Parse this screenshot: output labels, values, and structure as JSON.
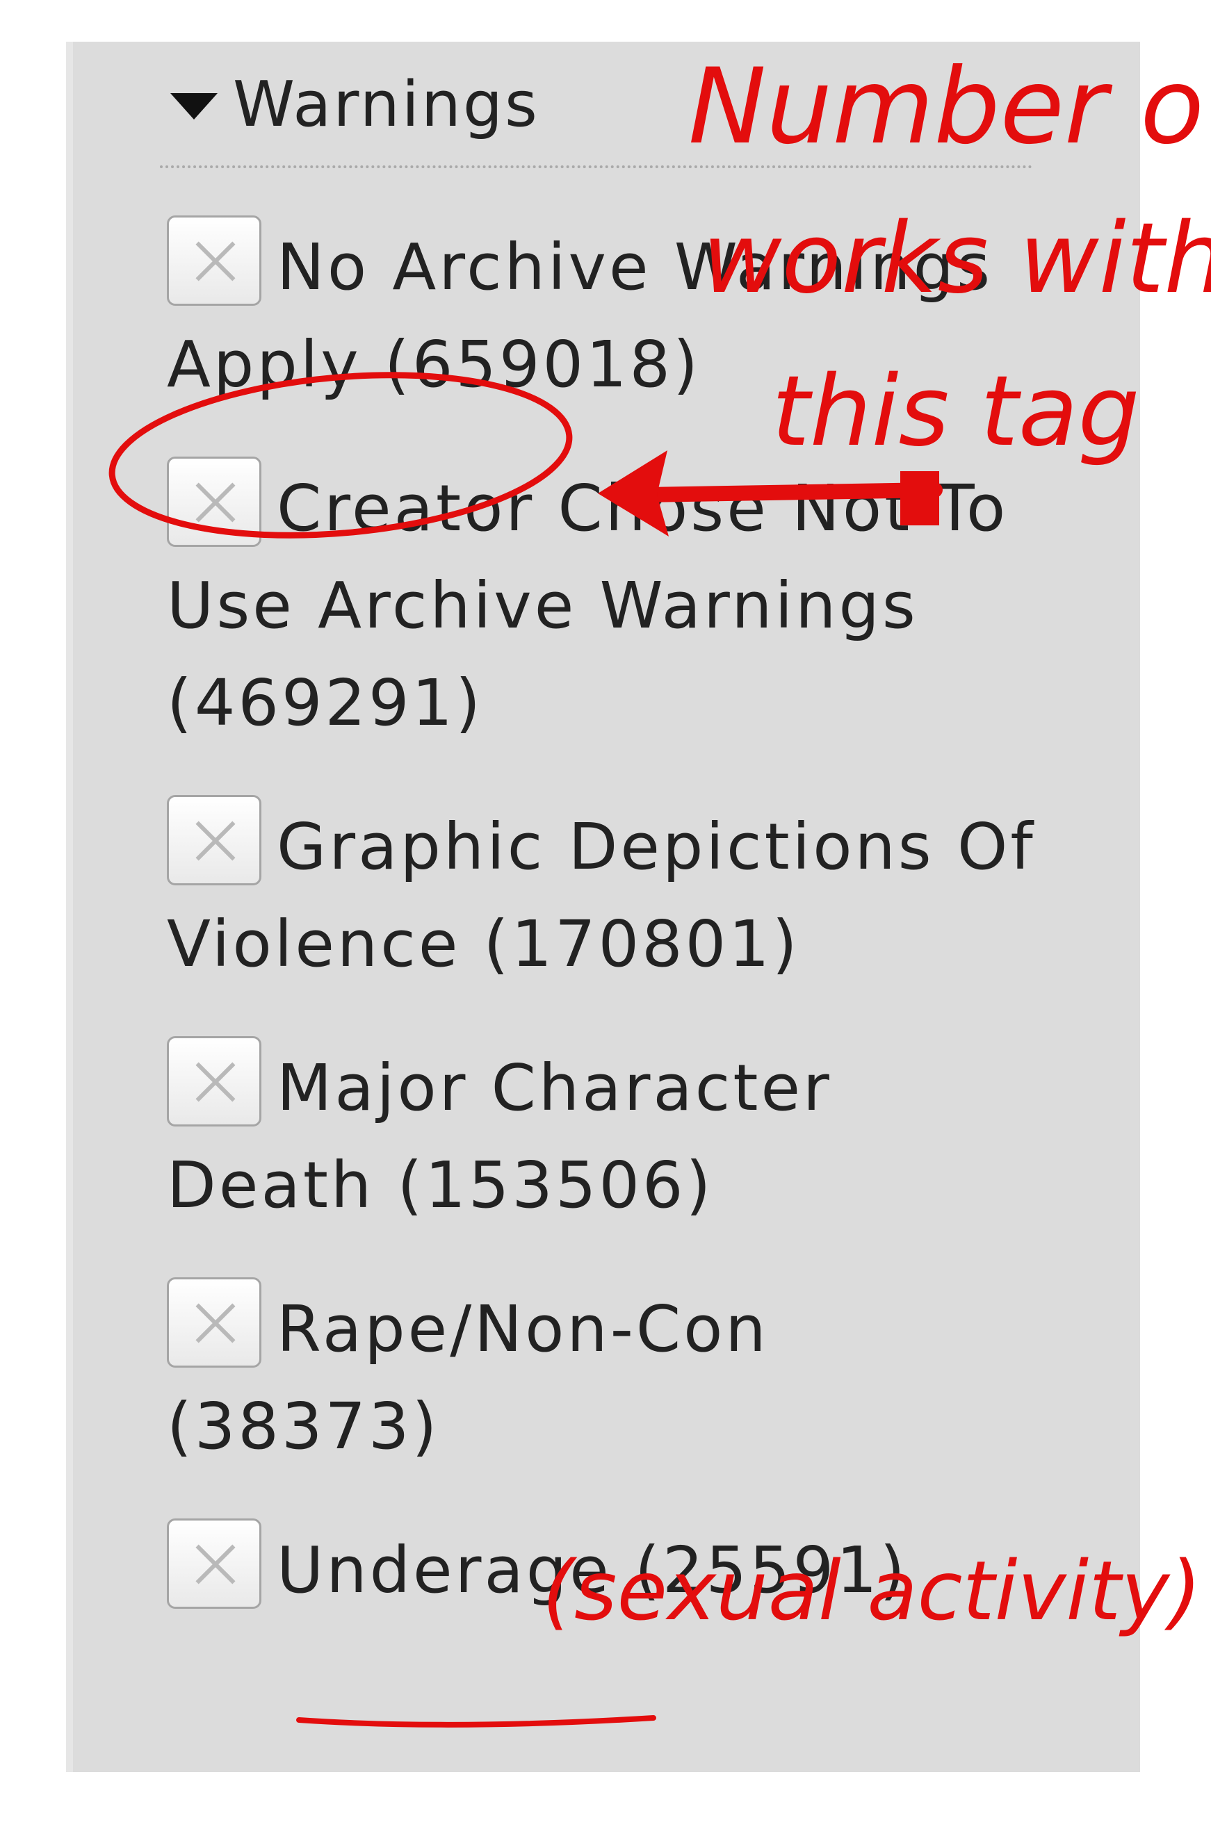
{
  "section": {
    "title": "Warnings",
    "collapse_icon": "triangle-down-icon"
  },
  "filters": [
    {
      "label": "No Archive Warnings Apply (659018)",
      "checkbox_icon": "x-icon"
    },
    {
      "label": "Creator Chose Not To Use Archive Warnings (469291)",
      "checkbox_icon": "x-icon"
    },
    {
      "label": "Graphic Depictions Of Violence (170801)",
      "checkbox_icon": "x-icon"
    },
    {
      "label": "Major Character Death (153506)",
      "checkbox_icon": "x-icon"
    },
    {
      "label": "Rape/Non-Con (38373)",
      "checkbox_icon": "x-icon"
    },
    {
      "label": "Underage (25591)",
      "checkbox_icon": "x-icon"
    }
  ],
  "annotations": {
    "note_line1": "Number of",
    "note_line2": "works with",
    "note_line3": "this tag",
    "note_bottom": "(sexual activity)",
    "color": "#e30d0d"
  },
  "colors": {
    "panel_background": "#dcdcdc",
    "text": "#222222"
  }
}
